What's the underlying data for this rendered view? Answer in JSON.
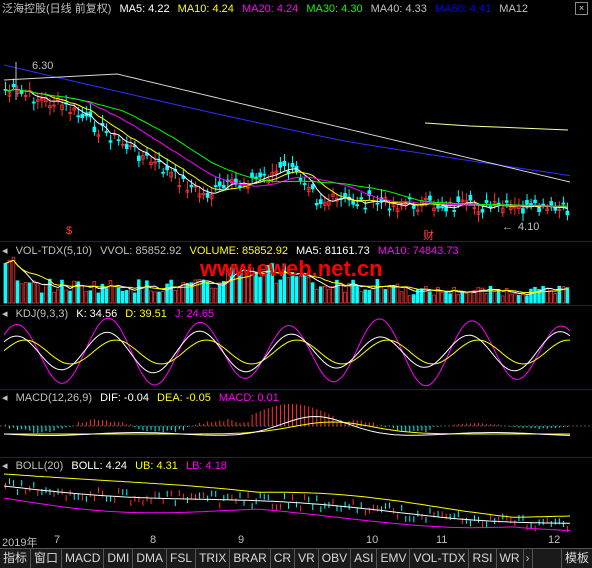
{
  "main_header": {
    "title": "泛海控股(日线 前复权)",
    "ma": [
      {
        "label": "MA5: 4.22",
        "color": "#ffffff"
      },
      {
        "label": "MA10: 4.24",
        "color": "#ffff00"
      },
      {
        "label": "MA20: 4.24",
        "color": "#ff00ff"
      },
      {
        "label": "MA30: 4.30",
        "color": "#00ff00"
      },
      {
        "label": "MA40: 4.33",
        "color": "#c0c0c0"
      },
      {
        "label": "MA60: 4.41",
        "color": "#0000ff"
      },
      {
        "label": "MA12",
        "color": "#c0c0c0"
      }
    ],
    "high_label": "6.30",
    "low_label": "4.10",
    "marker_cai": "财",
    "marker_dollar": "$"
  },
  "watermark": "www.eweb.net.cn",
  "vol_header": [
    {
      "text": "VOL-TDX(5,10)",
      "color": "#c0c0c0"
    },
    {
      "text": "VVOL: 85852.92",
      "color": "#c0c0c0"
    },
    {
      "text": "VOLUME: 85852.92",
      "color": "#ffff00"
    },
    {
      "text": "MA5: 81161.73",
      "color": "#ffffff"
    },
    {
      "text": "MA10: 74843.73",
      "color": "#ff00ff"
    }
  ],
  "kdj_header": [
    {
      "text": "KDJ(9,3,3)",
      "color": "#c0c0c0"
    },
    {
      "text": "K: 34.56",
      "color": "#ffffff"
    },
    {
      "text": "D: 39.51",
      "color": "#ffff00"
    },
    {
      "text": "J: 24.65",
      "color": "#ff00ff"
    }
  ],
  "macd_header": [
    {
      "text": "MACD(12,26,9)",
      "color": "#c0c0c0"
    },
    {
      "text": "DIF: -0.04",
      "color": "#ffffff"
    },
    {
      "text": "DEA: -0.05",
      "color": "#ffff00"
    },
    {
      "text": "MACD: 0.01",
      "color": "#ff00ff"
    }
  ],
  "boll_header": [
    {
      "text": "BOLL(20)",
      "color": "#c0c0c0"
    },
    {
      "text": "BOLL: 4.24",
      "color": "#ffffff"
    },
    {
      "text": "UB: 4.31",
      "color": "#ffff00"
    },
    {
      "text": "LB: 4.18",
      "color": "#ff00ff"
    }
  ],
  "x_axis": [
    "2019年",
    "7",
    "8",
    "9",
    "10",
    "11",
    "12"
  ],
  "tabs": [
    "指标",
    "窗口",
    "MACD",
    "DMI",
    "DMA",
    "FSL",
    "TRIX",
    "BRAR",
    "CR",
    "VR",
    "OBV",
    "ASI",
    "EMV",
    "VOL-TDX",
    "RSI",
    "WR"
  ],
  "tab_arrow": "›",
  "template_tab": "模板"
}
